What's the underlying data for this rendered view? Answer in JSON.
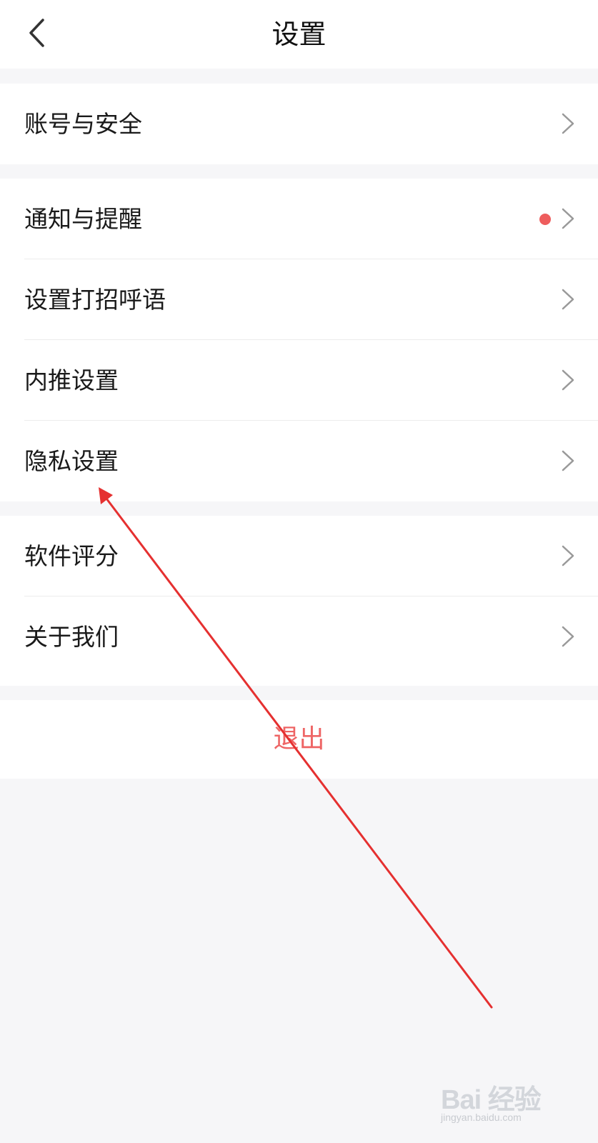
{
  "header": {
    "title": "设置"
  },
  "groups": [
    {
      "items": [
        {
          "label": "账号与安全"
        }
      ]
    },
    {
      "items": [
        {
          "label": "通知与提醒",
          "badge_dot": true
        },
        {
          "label": "设置打招呼语"
        },
        {
          "label": "内推设置"
        },
        {
          "label": "隐私设置"
        }
      ]
    },
    {
      "items": [
        {
          "label": "软件评分"
        },
        {
          "label": "关于我们"
        }
      ]
    }
  ],
  "logout": {
    "label": "退出"
  },
  "watermark": {
    "logo": "Bai 经验",
    "url": "jingyan.baidu.com"
  },
  "colors": {
    "background": "#f6f6f8",
    "accent_red": "#ee5d5d",
    "logout_text": "#ee6565",
    "annotation_arrow": "#e53030"
  },
  "icons": {
    "back": "chevron-left-icon",
    "row_arrow": "chevron-right-icon"
  }
}
